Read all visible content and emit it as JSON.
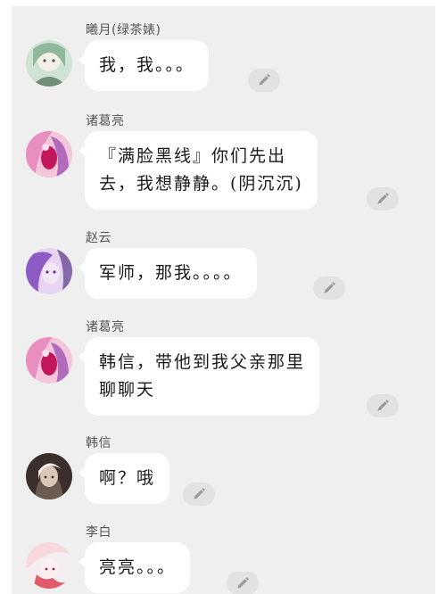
{
  "messages": [
    {
      "sender": "曦月(绿茶婊)",
      "lines": [
        "我，我。。。"
      ],
      "avatar_colors": [
        "#cfe3d4",
        "#8fb89a",
        "#f2efe6",
        "#6f8f78"
      ]
    },
    {
      "sender": "诸葛亮",
      "lines": [
        "『满脸黑线』你们先出",
        "去，我想静静。(阴沉沉)"
      ],
      "avatar_colors": [
        "#f4c6dc",
        "#c2185b",
        "#e88fc0",
        "#7b1fa2"
      ]
    },
    {
      "sender": "赵云",
      "lines": [
        "军师，那我。。。。"
      ],
      "avatar_colors": [
        "#e6d4f2",
        "#8e5cc4",
        "#f2e6f8",
        "#5b3a8c"
      ]
    },
    {
      "sender": "诸葛亮",
      "lines": [
        "韩信，带他到我父亲那里",
        "聊聊天"
      ],
      "avatar_colors": [
        "#f4c6dc",
        "#c2185b",
        "#e88fc0",
        "#7b1fa2"
      ]
    },
    {
      "sender": "韩信",
      "lines": [
        "啊？哦"
      ],
      "avatar_colors": [
        "#3a2f2c",
        "#d9c7b8",
        "#f2ece6",
        "#6b5a50"
      ]
    },
    {
      "sender": "李白",
      "lines": [
        "亮亮。。。"
      ],
      "avatar_colors": [
        "#f5eef0",
        "#e05a6a",
        "#f8d8dc",
        "#9c2a3a"
      ]
    }
  ],
  "edit_icon": "pencil-icon",
  "colors": {
    "panel_bg": "#efeff0",
    "bubble_bg": "#ffffff",
    "edit_button_bg": "#e2e2e4",
    "edit_icon": "#9a9a9e"
  }
}
